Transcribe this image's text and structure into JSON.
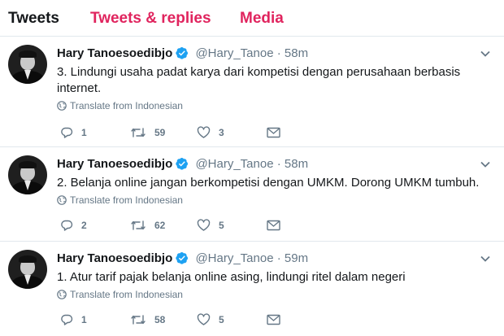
{
  "tabs": [
    {
      "label": "Tweets"
    },
    {
      "label": "Tweets & replies"
    },
    {
      "label": "Media"
    }
  ],
  "colors": {
    "accent": "#e0245e",
    "verified": "#1da1f2",
    "muted": "#657786",
    "text": "#14171a"
  },
  "tweets": [
    {
      "name": "Hary Tanoesoedibjo",
      "handle": "@Hary_Tanoe",
      "dot": "·",
      "time": "58m",
      "text": "3. Lindungi usaha padat karya dari kompetisi dengan perusahaan berbasis internet.",
      "translate": "Translate from Indonesian",
      "replies": "1",
      "retweets": "59",
      "likes": "3"
    },
    {
      "name": "Hary Tanoesoedibjo",
      "handle": "@Hary_Tanoe",
      "dot": "·",
      "time": "58m",
      "text": "2. Belanja online jangan berkompetisi dengan UMKM. Dorong UMKM tumbuh.",
      "translate": "Translate from Indonesian",
      "replies": "2",
      "retweets": "62",
      "likes": "5"
    },
    {
      "name": "Hary Tanoesoedibjo",
      "handle": "@Hary_Tanoe",
      "dot": "·",
      "time": "59m",
      "text": "1. Atur tarif pajak belanja online asing, lindungi ritel dalam negeri",
      "translate": "Translate from Indonesian",
      "replies": "1",
      "retweets": "58",
      "likes": "5"
    }
  ],
  "icons": {
    "verified": "verified-badge-icon",
    "caret": "chevron-down-icon",
    "globe": "globe-icon",
    "reply": "reply-icon",
    "retweet": "retweet-icon",
    "like": "heart-icon",
    "dm": "envelope-icon"
  }
}
